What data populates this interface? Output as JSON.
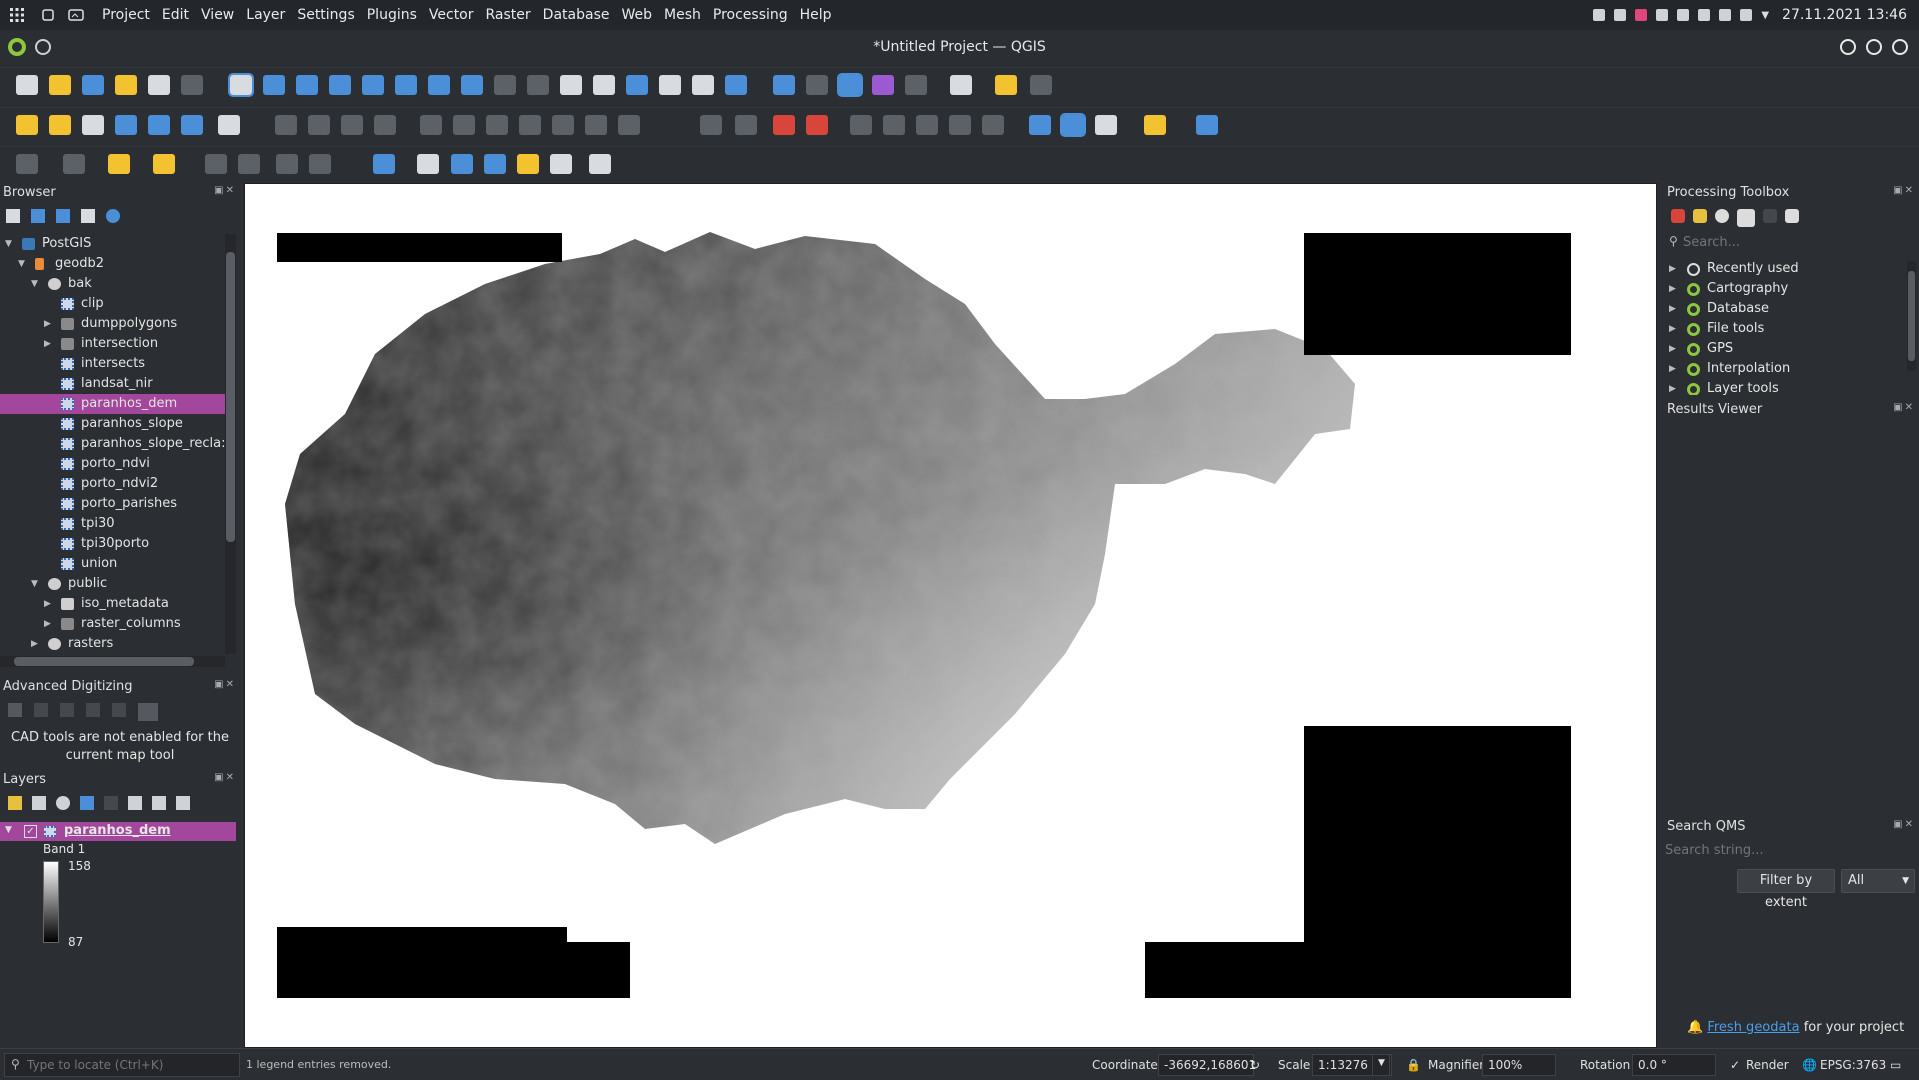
{
  "system_bar": {
    "menu": [
      "Project",
      "Edit",
      "View",
      "Layer",
      "Settings",
      "Plugins",
      "Vector",
      "Raster",
      "Database",
      "Web",
      "Mesh",
      "Processing",
      "Help"
    ],
    "clock": "27.11.2021 13:46"
  },
  "window": {
    "title": "*Untitled Project — QGIS"
  },
  "browser": {
    "title": "Browser",
    "tree": [
      {
        "label": "PostGIS",
        "level": 0,
        "expanded": true,
        "icon": "postgis-icon"
      },
      {
        "label": "geodb2",
        "level": 1,
        "expanded": true,
        "icon": "connection-icon"
      },
      {
        "label": "bak",
        "level": 2,
        "expanded": true,
        "icon": "schema-icon"
      },
      {
        "label": "clip",
        "level": 3,
        "icon": "raster-layer-icon"
      },
      {
        "label": "dumppolygons",
        "level": 3,
        "expandable": true,
        "icon": "polygon-layer-icon"
      },
      {
        "label": "intersection",
        "level": 3,
        "expandable": true,
        "icon": "polygon-layer-icon"
      },
      {
        "label": "intersects",
        "level": 3,
        "icon": "raster-layer-icon"
      },
      {
        "label": "landsat_nir",
        "level": 3,
        "icon": "raster-layer-icon"
      },
      {
        "label": "paranhos_dem",
        "level": 3,
        "icon": "raster-layer-icon",
        "selected": true
      },
      {
        "label": "paranhos_slope",
        "level": 3,
        "icon": "raster-layer-icon"
      },
      {
        "label": "paranhos_slope_recla:",
        "level": 3,
        "icon": "raster-layer-icon"
      },
      {
        "label": "porto_ndvi",
        "level": 3,
        "icon": "raster-layer-icon"
      },
      {
        "label": "porto_ndvi2",
        "level": 3,
        "icon": "raster-layer-icon"
      },
      {
        "label": "porto_parishes",
        "level": 3,
        "icon": "raster-layer-icon"
      },
      {
        "label": "tpi30",
        "level": 3,
        "icon": "raster-layer-icon"
      },
      {
        "label": "tpi30porto",
        "level": 3,
        "icon": "raster-layer-icon"
      },
      {
        "label": "union",
        "level": 3,
        "icon": "raster-layer-icon"
      },
      {
        "label": "public",
        "level": 2,
        "expanded": true,
        "icon": "schema-icon"
      },
      {
        "label": "iso_metadata",
        "level": 3,
        "expandable": true,
        "icon": "table-icon"
      },
      {
        "label": "raster_columns",
        "level": 3,
        "expandable": true,
        "icon": "polygon-layer-icon"
      },
      {
        "label": "rasters",
        "level": 2,
        "expandable": true,
        "icon": "schema-icon"
      }
    ]
  },
  "advanced_digitizing": {
    "title": "Advanced Digitizing",
    "message": "CAD tools are not enabled for the current map tool"
  },
  "layers": {
    "title": "Layers",
    "layer_name": "paranhos_dem",
    "checked": true,
    "band": "Band 1",
    "legend_max": "158",
    "legend_min": "87"
  },
  "processing_toolbox": {
    "title": "Processing Toolbox",
    "search_placeholder": "Search...",
    "items": [
      "Recently used",
      "Cartography",
      "Database",
      "File tools",
      "GPS",
      "Interpolation",
      "Layer tools"
    ]
  },
  "results_viewer": {
    "title": "Results Viewer"
  },
  "search_qms": {
    "title": "Search QMS",
    "placeholder": "Search string...",
    "filter_button": "Filter by extent",
    "filter_select": "All",
    "footer_link": "Fresh geodata",
    "footer_text": "for your project"
  },
  "status_bar": {
    "locator_placeholder": "Type to locate (Ctrl+K)",
    "message": "1 legend entries removed.",
    "coordinate_label": "Coordinate",
    "coordinate": "-36692,168601",
    "scale_label": "Scale",
    "scale": "1:13276",
    "magnifier_label": "Magnifier",
    "magnifier": "100%",
    "rotation_label": "Rotation",
    "rotation": "0.0 °",
    "render_label": "Render",
    "crs": "EPSG:3763"
  },
  "colors": {
    "selection": "#a3479c",
    "qgis_green": "#8dc63f",
    "link": "#4a9ee8"
  }
}
